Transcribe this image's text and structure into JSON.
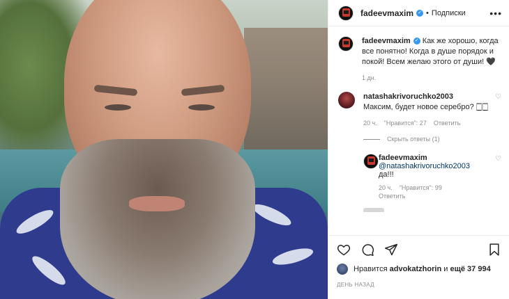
{
  "header": {
    "username": "fadeevmaxim",
    "separator": "•",
    "follow_label": "Подписки",
    "more": "•••"
  },
  "caption": {
    "username": "fadeevmaxim",
    "text": "Как же хорошо, когда все понятно! Когда в душе порядок и покой! Всем желаю этого от души! 🖤",
    "time": "1 дн."
  },
  "comments": [
    {
      "username": "natashakrivoruchko2003",
      "text": "Максим, будет новое серебро? 🀆🀆",
      "time": "20 ч.",
      "likes": "\"Нравится\": 27",
      "reply_label": "Ответить",
      "view_replies": "Скрыть ответы (1)"
    }
  ],
  "reply": {
    "username": "fadeevmaxim",
    "mention": "@natashakrivoruchko2003",
    "text": " да!!!",
    "time": "20 ч.",
    "likes": "\"Нравится\": 99",
    "reply_label": "Ответить"
  },
  "likes_line": {
    "prefix": "Нравится",
    "user": "advokatzhorin",
    "connector": "и",
    "rest": "ещё 37 994"
  },
  "date_label": "ДЕНЬ НАЗАД",
  "icons": [
    "heart-icon",
    "comment-icon",
    "share-icon",
    "bookmark-icon",
    "verified-icon",
    "more-icon"
  ]
}
